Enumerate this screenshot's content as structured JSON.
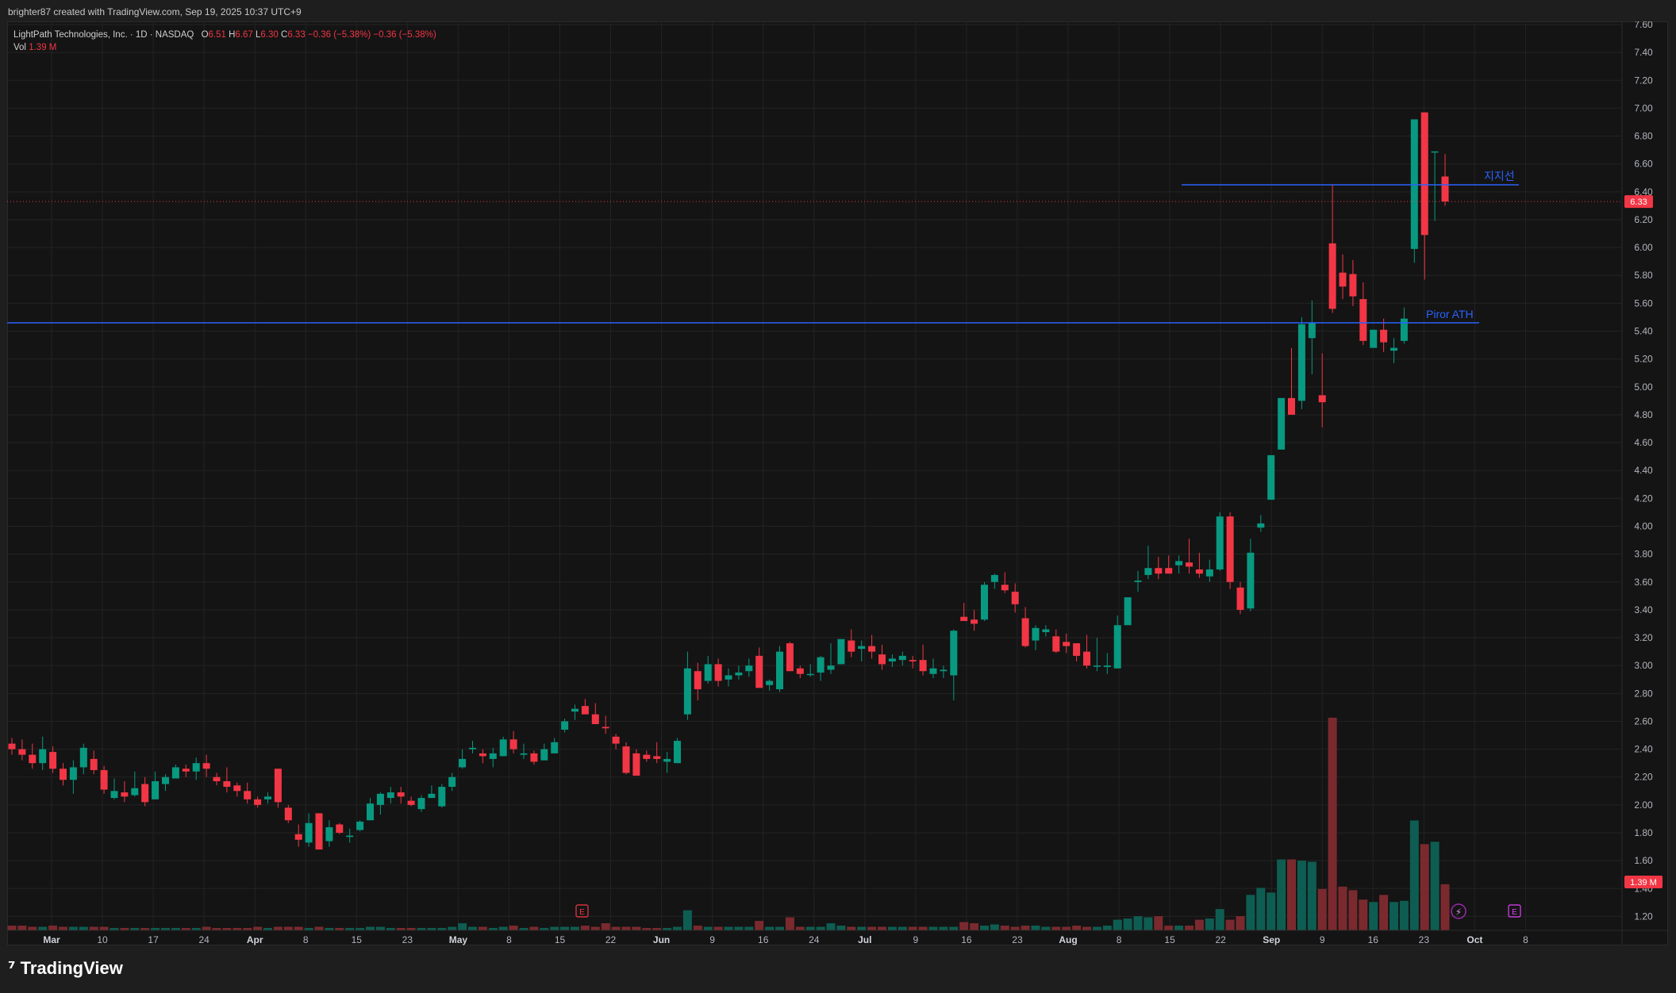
{
  "header": {
    "attribution": "brighter87 created with TradingView.com, Sep 19, 2025 10:37 UTC+9"
  },
  "legend": {
    "symbol": "LightPath Technologies, Inc. · 1D · NASDAQ",
    "open_label": "O",
    "open": "6.51",
    "high_label": "H",
    "high": "6.67",
    "low_label": "L",
    "low": "6.30",
    "close_label": "C",
    "close": "6.33",
    "change": "−0.36 (−5.38%)",
    "change2": "−0.36 (−5.38%)",
    "vol_label": "Vol",
    "vol": "1.39 M"
  },
  "footer": {
    "brand": "TradingView"
  },
  "colors": {
    "up": "#089981",
    "down": "#f23645",
    "level_line": "#2962ff",
    "background": "#141414",
    "grid": "#232323"
  },
  "chart_data": {
    "type": "candlestick",
    "ylim": [
      1.1,
      7.6
    ],
    "y_ticks": [
      "1.20",
      "1.40",
      "1.60",
      "1.80",
      "2.00",
      "2.20",
      "2.40",
      "2.60",
      "2.80",
      "3.00",
      "3.20",
      "3.40",
      "3.60",
      "3.80",
      "4.00",
      "4.20",
      "4.40",
      "4.60",
      "4.80",
      "5.00",
      "5.20",
      "5.40",
      "5.60",
      "5.80",
      "6.00",
      "6.20",
      "6.40",
      "6.60",
      "6.80",
      "7.00",
      "7.20",
      "7.40",
      "7.60"
    ],
    "x_ticks": [
      {
        "label": "Mar",
        "bold": true
      },
      {
        "label": "10"
      },
      {
        "label": "17"
      },
      {
        "label": "24"
      },
      {
        "label": "Apr",
        "bold": true
      },
      {
        "label": "8"
      },
      {
        "label": "15"
      },
      {
        "label": "23"
      },
      {
        "label": "May",
        "bold": true
      },
      {
        "label": "8"
      },
      {
        "label": "15"
      },
      {
        "label": "22"
      },
      {
        "label": "Jun",
        "bold": true
      },
      {
        "label": "9"
      },
      {
        "label": "16"
      },
      {
        "label": "24"
      },
      {
        "label": "Jul",
        "bold": true
      },
      {
        "label": "9"
      },
      {
        "label": "16"
      },
      {
        "label": "23"
      },
      {
        "label": "Aug",
        "bold": true
      },
      {
        "label": "8"
      },
      {
        "label": "15"
      },
      {
        "label": "22"
      },
      {
        "label": "Sep",
        "bold": true
      },
      {
        "label": "9"
      },
      {
        "label": "16"
      },
      {
        "label": "23"
      },
      {
        "label": "Oct",
        "bold": true
      },
      {
        "label": "8"
      }
    ],
    "last_price_label": "6.33",
    "last_price": 6.33,
    "volume_label": "1.39 M",
    "annotations": [
      {
        "text": "지지선",
        "price": 6.45
      },
      {
        "text": "Piror ATH",
        "price": 5.46
      }
    ],
    "event_markers": [
      {
        "label": "E",
        "kind": "earnings"
      },
      {
        "label": "E",
        "kind": "earnings-upcoming"
      },
      {
        "label": "⚡",
        "kind": "dividend-split"
      }
    ],
    "candles": [
      [
        2.44,
        2.48,
        2.36,
        2.4,
        0.4
      ],
      [
        2.4,
        2.47,
        2.32,
        2.36,
        0.4
      ],
      [
        2.36,
        2.44,
        2.26,
        2.3,
        0.3
      ],
      [
        2.3,
        2.49,
        2.25,
        2.4,
        0.3
      ],
      [
        2.38,
        2.42,
        2.23,
        2.26,
        0.4
      ],
      [
        2.26,
        2.3,
        2.14,
        2.18,
        0.3
      ],
      [
        2.18,
        2.32,
        2.08,
        2.27,
        0.3
      ],
      [
        2.27,
        2.44,
        2.22,
        2.41,
        0.3
      ],
      [
        2.33,
        2.39,
        2.22,
        2.25,
        0.3
      ],
      [
        2.25,
        2.28,
        2.08,
        2.11,
        0.3
      ],
      [
        2.05,
        2.19,
        2.04,
        2.1,
        0.2
      ],
      [
        2.09,
        2.17,
        2.02,
        2.06,
        0.2
      ],
      [
        2.07,
        2.24,
        2.06,
        2.12,
        0.2
      ],
      [
        2.15,
        2.2,
        1.99,
        2.02,
        0.2
      ],
      [
        2.04,
        2.24,
        2.04,
        2.17,
        0.2
      ],
      [
        2.15,
        2.22,
        2.1,
        2.2,
        0.2
      ],
      [
        2.19,
        2.29,
        2.2,
        2.27,
        0.2
      ],
      [
        2.26,
        2.29,
        2.2,
        2.24,
        0.2
      ],
      [
        2.24,
        2.34,
        2.18,
        2.3,
        0.2
      ],
      [
        2.3,
        2.36,
        2.2,
        2.26,
        0.3
      ],
      [
        2.2,
        2.23,
        2.14,
        2.17,
        0.2
      ],
      [
        2.17,
        2.27,
        2.09,
        2.13,
        0.2
      ],
      [
        2.14,
        2.16,
        2.06,
        2.1,
        0.2
      ],
      [
        2.1,
        2.16,
        2.01,
        2.04,
        0.2
      ],
      [
        2.04,
        2.06,
        1.98,
        2.0,
        0.3
      ],
      [
        2.04,
        2.09,
        2.01,
        2.06,
        0.2
      ],
      [
        2.26,
        2.26,
        1.98,
        2.02,
        0.3
      ],
      [
        1.98,
        2.0,
        1.87,
        1.89,
        0.3
      ],
      [
        1.79,
        1.86,
        1.7,
        1.75,
        0.3
      ],
      [
        1.73,
        1.94,
        1.7,
        1.87,
        0.2
      ],
      [
        1.94,
        1.94,
        1.69,
        1.68,
        0.3
      ],
      [
        1.74,
        1.89,
        1.7,
        1.84,
        0.2
      ],
      [
        1.86,
        1.87,
        1.79,
        1.8,
        0.2
      ],
      [
        1.77,
        1.83,
        1.73,
        1.78,
        0.2
      ],
      [
        1.82,
        1.89,
        1.81,
        1.88,
        0.2
      ],
      [
        1.89,
        2.05,
        1.91,
        2.01,
        0.3
      ],
      [
        2.0,
        2.09,
        1.93,
        2.08,
        0.3
      ],
      [
        2.05,
        2.13,
        2.01,
        2.09,
        0.2
      ],
      [
        2.09,
        2.13,
        2.01,
        2.06,
        0.2
      ],
      [
        2.03,
        2.06,
        1.99,
        2.0,
        0.2
      ],
      [
        1.97,
        2.07,
        1.95,
        2.05,
        0.2
      ],
      [
        2.05,
        2.14,
        2.05,
        2.08,
        0.2
      ],
      [
        1.99,
        2.15,
        1.98,
        2.13,
        0.2
      ],
      [
        2.13,
        2.23,
        2.1,
        2.2,
        0.3
      ],
      [
        2.27,
        2.4,
        2.26,
        2.33,
        0.6
      ],
      [
        2.4,
        2.46,
        2.37,
        2.41,
        0.3
      ],
      [
        2.37,
        2.4,
        2.3,
        2.35,
        0.3
      ],
      [
        2.33,
        2.41,
        2.27,
        2.37,
        0.2
      ],
      [
        2.35,
        2.49,
        2.38,
        2.47,
        0.3
      ],
      [
        2.47,
        2.53,
        2.37,
        2.4,
        0.4
      ],
      [
        2.36,
        2.44,
        2.33,
        2.37,
        0.2
      ],
      [
        2.37,
        2.39,
        2.29,
        2.31,
        0.3
      ],
      [
        2.32,
        2.44,
        2.38,
        2.4,
        0.2
      ],
      [
        2.37,
        2.48,
        2.4,
        2.45,
        0.3
      ],
      [
        2.54,
        2.62,
        2.52,
        2.6,
        0.3
      ],
      [
        2.67,
        2.72,
        2.61,
        2.69,
        0.3
      ],
      [
        2.71,
        2.76,
        2.67,
        2.65,
        0.4
      ],
      [
        2.65,
        2.73,
        2.6,
        2.58,
        0.3
      ],
      [
        2.56,
        2.64,
        2.51,
        2.55,
        0.6
      ],
      [
        2.49,
        2.51,
        2.4,
        2.44,
        0.3
      ],
      [
        2.42,
        2.45,
        2.22,
        2.23,
        0.3
      ],
      [
        2.37,
        2.4,
        2.22,
        2.21,
        0.3
      ],
      [
        2.36,
        2.39,
        2.31,
        2.33,
        0.2
      ],
      [
        2.35,
        2.45,
        2.3,
        2.33,
        0.2
      ],
      [
        2.31,
        2.38,
        2.23,
        2.33,
        0.2
      ],
      [
        2.3,
        2.48,
        2.3,
        2.46,
        0.3
      ],
      [
        2.65,
        3.1,
        2.61,
        2.98,
        1.7
      ],
      [
        2.96,
        3.02,
        2.75,
        2.83,
        0.4
      ],
      [
        2.89,
        3.07,
        2.87,
        3.01,
        0.3
      ],
      [
        3.01,
        3.05,
        2.85,
        2.89,
        0.3
      ],
      [
        2.9,
        2.98,
        2.85,
        2.93,
        0.3
      ],
      [
        2.93,
        3.0,
        2.9,
        2.95,
        0.3
      ],
      [
        2.96,
        3.05,
        2.92,
        3.0,
        0.3
      ],
      [
        3.07,
        3.13,
        2.87,
        2.84,
        0.8
      ],
      [
        2.86,
        2.9,
        2.82,
        2.89,
        0.3
      ],
      [
        2.83,
        3.14,
        2.81,
        3.1,
        0.3
      ],
      [
        3.16,
        3.17,
        2.96,
        2.96,
        1.1
      ],
      [
        2.98,
        3.0,
        2.91,
        2.94,
        0.3
      ],
      [
        2.94,
        3.01,
        2.92,
        2.94,
        0.3
      ],
      [
        2.95,
        3.07,
        2.89,
        3.06,
        0.3
      ],
      [
        2.97,
        3.16,
        2.94,
        3.0,
        0.6
      ],
      [
        3.01,
        3.19,
        3.01,
        3.19,
        0.4
      ],
      [
        3.18,
        3.26,
        3.06,
        3.1,
        0.3
      ],
      [
        3.12,
        3.18,
        3.03,
        3.14,
        0.3
      ],
      [
        3.14,
        3.22,
        3.05,
        3.1,
        0.3
      ],
      [
        3.08,
        3.15,
        2.97,
        3.01,
        0.3
      ],
      [
        3.03,
        3.08,
        2.99,
        3.05,
        0.3
      ],
      [
        3.04,
        3.1,
        3.0,
        3.07,
        0.3
      ],
      [
        3.04,
        3.07,
        2.98,
        3.03,
        0.3
      ],
      [
        3.04,
        3.15,
        2.93,
        2.96,
        0.3
      ],
      [
        2.94,
        3.05,
        2.91,
        2.98,
        0.3
      ],
      [
        2.96,
        3.0,
        2.91,
        2.97,
        0.3
      ],
      [
        2.93,
        3.26,
        2.75,
        3.25,
        0.3
      ],
      [
        3.35,
        3.45,
        3.32,
        3.32,
        0.7
      ],
      [
        3.33,
        3.4,
        3.25,
        3.3,
        0.6
      ],
      [
        3.33,
        3.6,
        3.32,
        3.58,
        0.4
      ],
      [
        3.6,
        3.66,
        3.55,
        3.65,
        0.5
      ],
      [
        3.58,
        3.67,
        3.52,
        3.54,
        0.4
      ],
      [
        3.53,
        3.59,
        3.38,
        3.44,
        0.3
      ],
      [
        3.34,
        3.42,
        3.13,
        3.14,
        0.4
      ],
      [
        3.18,
        3.29,
        3.11,
        3.27,
        0.4
      ],
      [
        3.24,
        3.29,
        3.21,
        3.26,
        0.3
      ],
      [
        3.21,
        3.26,
        3.09,
        3.1,
        0.3
      ],
      [
        3.17,
        3.23,
        3.09,
        3.14,
        0.3
      ],
      [
        3.16,
        3.16,
        3.03,
        3.07,
        0.4
      ],
      [
        3.1,
        3.22,
        2.98,
        3.0,
        0.3
      ],
      [
        3.0,
        3.2,
        2.96,
        3.0,
        0.3
      ],
      [
        2.99,
        3.09,
        2.94,
        3.0,
        0.4
      ],
      [
        2.98,
        3.36,
        2.99,
        3.29,
        0.9
      ],
      [
        3.29,
        3.49,
        3.3,
        3.49,
        1.0
      ],
      [
        3.6,
        3.68,
        3.53,
        3.61,
        1.2
      ],
      [
        3.65,
        3.86,
        3.62,
        3.7,
        1.1
      ],
      [
        3.7,
        3.78,
        3.62,
        3.66,
        1.2
      ],
      [
        3.7,
        3.79,
        3.67,
        3.66,
        0.4
      ],
      [
        3.72,
        3.79,
        3.66,
        3.75,
        0.4
      ],
      [
        3.74,
        3.91,
        3.66,
        3.71,
        0.4
      ],
      [
        3.69,
        3.81,
        3.63,
        3.66,
        0.9
      ],
      [
        3.64,
        3.76,
        3.6,
        3.69,
        1.0
      ],
      [
        3.69,
        4.1,
        3.68,
        4.07,
        1.8
      ],
      [
        4.07,
        4.1,
        3.55,
        3.6,
        0.9
      ],
      [
        3.56,
        3.6,
        3.37,
        3.4,
        1.2
      ],
      [
        3.41,
        3.91,
        3.39,
        3.81,
        3.0
      ],
      [
        3.99,
        4.08,
        3.96,
        4.02,
        3.6
      ],
      [
        4.19,
        4.31,
        4.2,
        4.51,
        3.2
      ],
      [
        4.55,
        4.87,
        4.55,
        4.92,
        6.0
      ],
      [
        4.92,
        5.28,
        4.88,
        4.8,
        6.0
      ],
      [
        4.9,
        5.5,
        4.84,
        5.45,
        5.9
      ],
      [
        5.35,
        5.62,
        5.09,
        5.46,
        5.8
      ],
      [
        4.94,
        5.24,
        4.71,
        4.89,
        3.5
      ],
      [
        6.03,
        6.45,
        5.53,
        5.56,
        18.0
      ],
      [
        5.82,
        5.95,
        5.63,
        5.72,
        3.7
      ],
      [
        5.81,
        5.91,
        5.58,
        5.65,
        3.4
      ],
      [
        5.63,
        5.75,
        5.3,
        5.33,
        2.6
      ],
      [
        5.28,
        5.39,
        5.29,
        5.41,
        2.4
      ],
      [
        5.41,
        5.49,
        5.25,
        5.32,
        3.0
      ],
      [
        5.26,
        5.35,
        5.17,
        5.28,
        2.4
      ],
      [
        5.33,
        5.57,
        5.31,
        5.49,
        2.5
      ],
      [
        5.99,
        6.92,
        5.89,
        6.92,
        9.3
      ],
      [
        6.97,
        6.97,
        5.77,
        6.09,
        7.3
      ],
      [
        6.69,
        6.69,
        6.19,
        6.69,
        7.5
      ],
      [
        6.51,
        6.67,
        6.3,
        6.33,
        3.9
      ]
    ],
    "volume_scale_max": 19
  }
}
